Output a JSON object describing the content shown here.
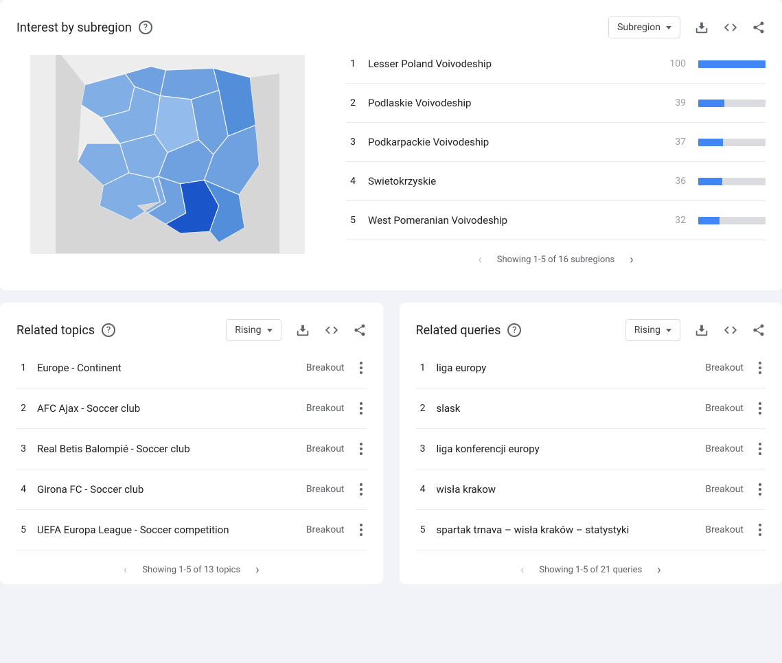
{
  "subregion": {
    "title": "Interest by subregion",
    "selector": "Subregion",
    "pager": "Showing 1-5 of 16 subregions",
    "rows": [
      {
        "rank": "1",
        "name": "Lesser Poland Voivodeship",
        "value": "100",
        "pct": 100
      },
      {
        "rank": "2",
        "name": "Podlaskie Voivodeship",
        "value": "39",
        "pct": 39
      },
      {
        "rank": "3",
        "name": "Podkarpackie Voivodeship",
        "value": "37",
        "pct": 37
      },
      {
        "rank": "4",
        "name": "Swietokrzyskie",
        "value": "36",
        "pct": 36
      },
      {
        "rank": "5",
        "name": "West Pomeranian Voivodeship",
        "value": "32",
        "pct": 32
      }
    ]
  },
  "topics": {
    "title": "Related topics",
    "selector": "Rising",
    "pager": "Showing 1-5 of 13 topics",
    "rows": [
      {
        "rank": "1",
        "name": "Europe - Continent",
        "badge": "Breakout"
      },
      {
        "rank": "2",
        "name": "AFC Ajax - Soccer club",
        "badge": "Breakout"
      },
      {
        "rank": "3",
        "name": "Real Betis Balompié - Soccer club",
        "badge": "Breakout"
      },
      {
        "rank": "4",
        "name": "Girona FC - Soccer club",
        "badge": "Breakout"
      },
      {
        "rank": "5",
        "name": "UEFA Europa League - Soccer competition",
        "badge": "Breakout"
      }
    ]
  },
  "queries": {
    "title": "Related queries",
    "selector": "Rising",
    "pager": "Showing 1-5 of 21 queries",
    "rows": [
      {
        "rank": "1",
        "name": "liga europy",
        "badge": "Breakout"
      },
      {
        "rank": "2",
        "name": "slask",
        "badge": "Breakout"
      },
      {
        "rank": "3",
        "name": "liga konferencji europy",
        "badge": "Breakout"
      },
      {
        "rank": "4",
        "name": "wisła krakow",
        "badge": "Breakout"
      },
      {
        "rank": "5",
        "name": "spartak trnava – wisła kraków – statystyki",
        "badge": "Breakout"
      }
    ]
  }
}
